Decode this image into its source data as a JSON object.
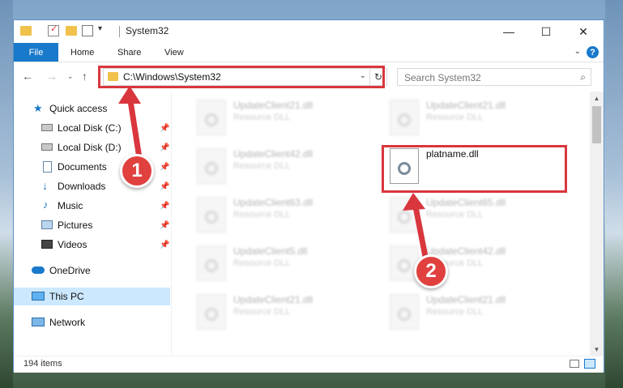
{
  "window": {
    "title": "System32",
    "controls": {
      "minimize": "—",
      "maximize": "☐",
      "close": "✕"
    }
  },
  "ribbon": {
    "tabs": [
      {
        "label": "File"
      },
      {
        "label": "Home"
      },
      {
        "label": "Share"
      },
      {
        "label": "View"
      }
    ],
    "help_label": "?"
  },
  "navigation": {
    "address": "C:\\Windows\\System32",
    "search_placeholder": "Search System32"
  },
  "sidebar": {
    "items": [
      {
        "label": "Quick access",
        "icon": "star-icon"
      },
      {
        "label": "Local Disk (C:)",
        "icon": "drive-icon",
        "pinned": true
      },
      {
        "label": "Local Disk (D:)",
        "icon": "drive-icon",
        "pinned": true
      },
      {
        "label": "Documents",
        "icon": "documents-icon",
        "pinned": true
      },
      {
        "label": "Downloads",
        "icon": "downloads-icon",
        "pinned": true
      },
      {
        "label": "Music",
        "icon": "music-icon",
        "pinned": true
      },
      {
        "label": "Pictures",
        "icon": "pictures-icon",
        "pinned": true
      },
      {
        "label": "Videos",
        "icon": "videos-icon",
        "pinned": true
      },
      {
        "label": "OneDrive",
        "icon": "cloud-icon"
      },
      {
        "label": "This PC",
        "icon": "computer-icon",
        "selected": true
      },
      {
        "label": "Network",
        "icon": "network-icon"
      }
    ]
  },
  "files": {
    "left_column": [
      {
        "name": "UpdateClient21.dll",
        "type": "Resource DLL"
      },
      {
        "name": "UpdateClient42.dll",
        "type": "Resource DLL"
      },
      {
        "name": "UpdateClient63.dll",
        "type": "Resource DLL"
      },
      {
        "name": "UpdateClient5.dll",
        "type": "Resource DLL"
      },
      {
        "name": "UpdateClient21.dll",
        "type": "Resource DLL"
      }
    ],
    "right_column": [
      {
        "name": "UpdateClient21.dll",
        "type": "Resource DLL"
      },
      {
        "name": "platname.dll",
        "type": ""
      },
      {
        "name": "UpdateClient65.dll",
        "type": "Resource DLL"
      },
      {
        "name": "UpdateClient42.dll",
        "type": "Resource DLL"
      },
      {
        "name": "UpdateClient21.dll",
        "type": "Resource DLL"
      }
    ]
  },
  "status": {
    "item_count": "194 items"
  },
  "annotations": {
    "badge_1": "1",
    "badge_2": "2",
    "color": "#d9363e"
  }
}
